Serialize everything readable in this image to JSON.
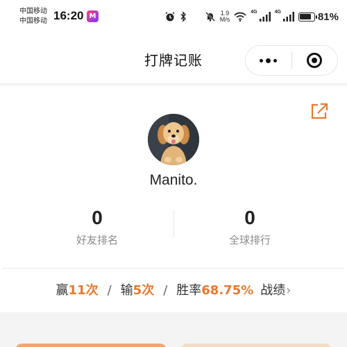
{
  "status_bar": {
    "carrier_1": "中国移动",
    "carrier_2": "中国移动",
    "time": "16:20",
    "app_badge": "M",
    "speed_value": "1.9",
    "speed_unit": "M/s",
    "net_tag_1": "4G",
    "net_tag_2": "4G",
    "battery_level": 0.81,
    "battery_text": "81%",
    "icons": [
      "alarm-icon",
      "bluetooth-icon",
      "mute-icon",
      "wifi-icon",
      "signal-icon",
      "battery-icon"
    ]
  },
  "nav": {
    "title": "打牌记账",
    "more_icon": "more-dots-icon",
    "close_icon": "close-target-icon"
  },
  "profile": {
    "username": "Manito.",
    "share_icon": "share-icon",
    "avatar_icon": "dog-avatar",
    "stats": [
      {
        "value": "0",
        "label": "好友排名"
      },
      {
        "value": "0",
        "label": "全球排行"
      }
    ]
  },
  "record": {
    "win_label": "赢",
    "win_count": "11次",
    "separator": "/",
    "lose_label": "输",
    "lose_count": "5次",
    "rate_label": "胜率",
    "rate_value": "68.75%",
    "record_link": "战绩",
    "chevron": "›"
  },
  "colors": {
    "accent": "#e8792f",
    "text": "#222222",
    "muted": "#8a8a8a"
  }
}
